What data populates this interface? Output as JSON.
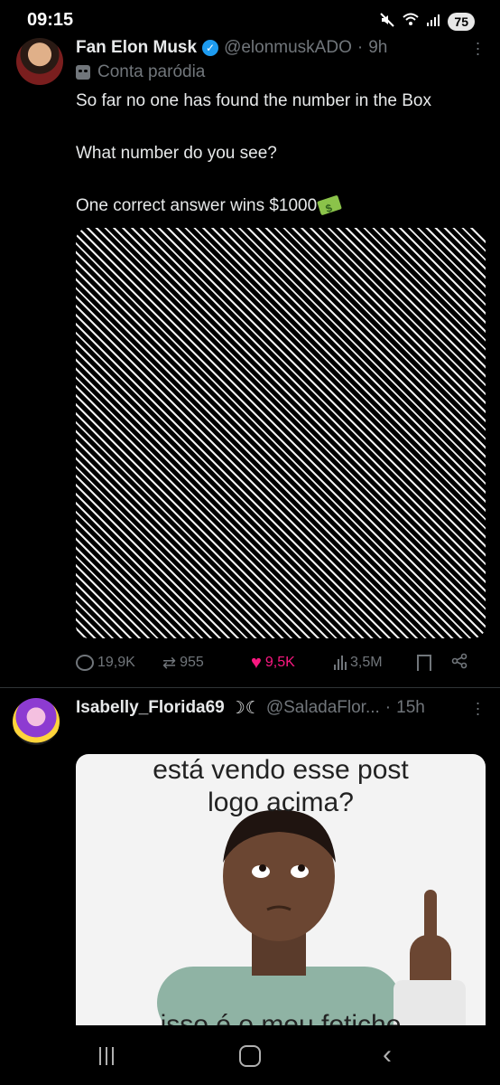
{
  "status_bar": {
    "time": "09:15",
    "battery": "75",
    "icons": [
      "mute-icon",
      "wifi-icon",
      "signal-icon"
    ]
  },
  "tweet1": {
    "display_name": "Fan Elon Musk",
    "handle": "@elonmuskADO",
    "time": "9h",
    "parody_label": "Conta paródia",
    "text_lines": [
      "So far no one has found the number in the Box",
      "What number do you see?",
      "One correct answer wins $1000"
    ],
    "actions": {
      "replies": "19,9K",
      "retweets": "955",
      "likes": "9,5K",
      "views": "3,5M"
    },
    "accent_like": "#f91880",
    "verified_color": "#1d9bf0"
  },
  "tweet2": {
    "display_name": "Isabelly_Florida69",
    "name_suffix": "☽☾",
    "handle": "@SaladaFlor...",
    "time": "15h",
    "meme_caption_top": "está vendo esse post\nlogo acima?",
    "meme_caption_bottom": "isso é o meu fetiche"
  }
}
